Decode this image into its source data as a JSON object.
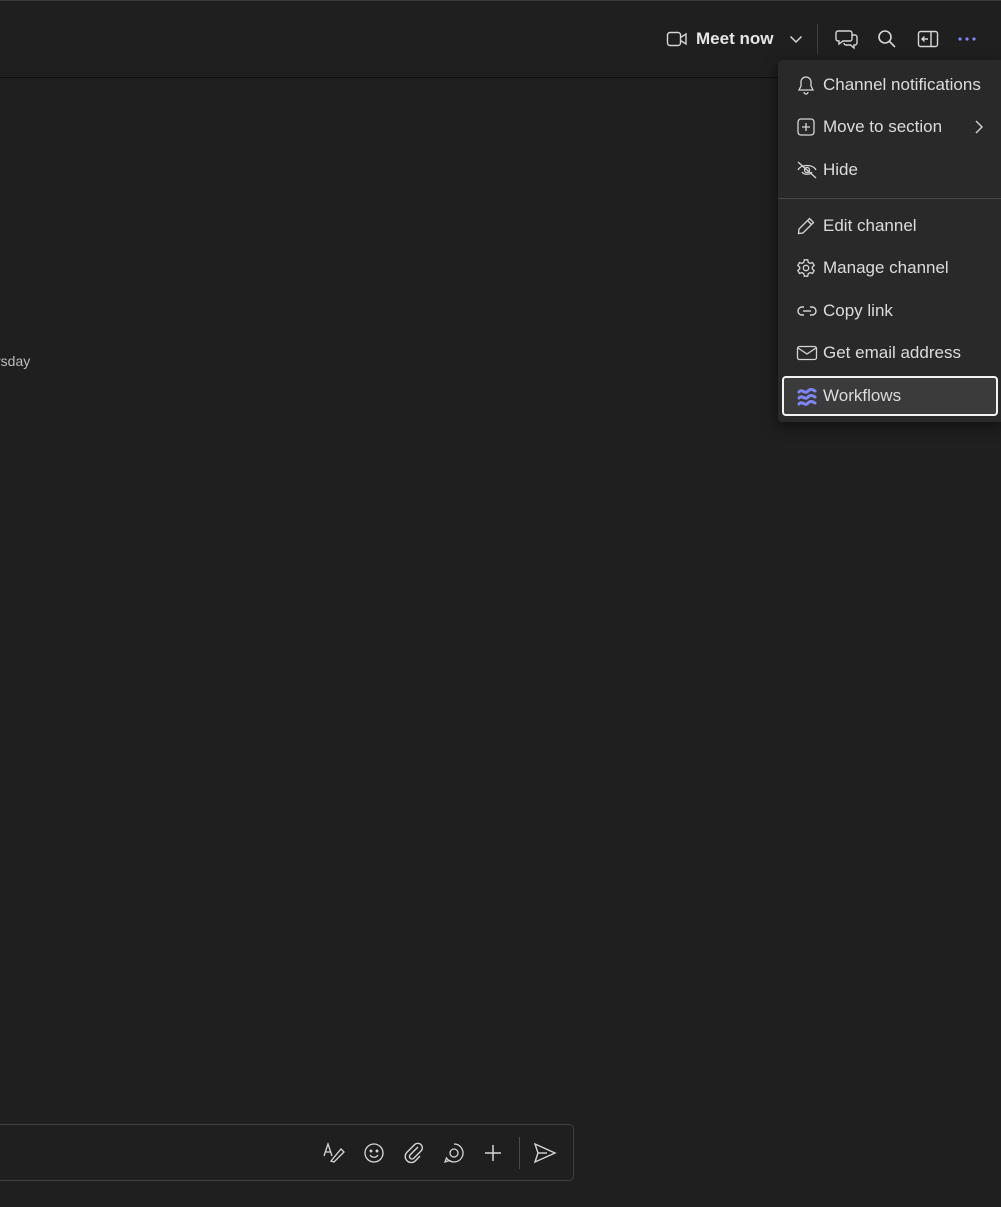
{
  "header": {
    "meet_now_label": "Meet now"
  },
  "content": {
    "day_label": "rsday"
  },
  "menu": {
    "items": [
      {
        "label": "Channel notifications",
        "icon": "bell-icon"
      },
      {
        "label": "Move to section",
        "icon": "add-square-icon",
        "has_submenu": true
      },
      {
        "label": "Hide",
        "icon": "eye-off-icon"
      },
      {
        "label": "Edit channel",
        "icon": "pencil-icon"
      },
      {
        "label": "Manage channel",
        "icon": "gear-icon"
      },
      {
        "label": "Copy link",
        "icon": "link-icon"
      },
      {
        "label": "Get email address",
        "icon": "mail-icon"
      },
      {
        "label": "Workflows",
        "icon": "workflows-icon",
        "focused": true
      }
    ]
  },
  "compose_toolbar": {
    "buttons": [
      "format-icon",
      "emoji-icon",
      "attach-icon",
      "loop-icon",
      "plus-icon",
      "send-icon"
    ]
  },
  "colors": {
    "background": "#1f1f1f",
    "menu_background": "#292929",
    "accent": "#7f85f5",
    "text": "#dcdcdc"
  }
}
